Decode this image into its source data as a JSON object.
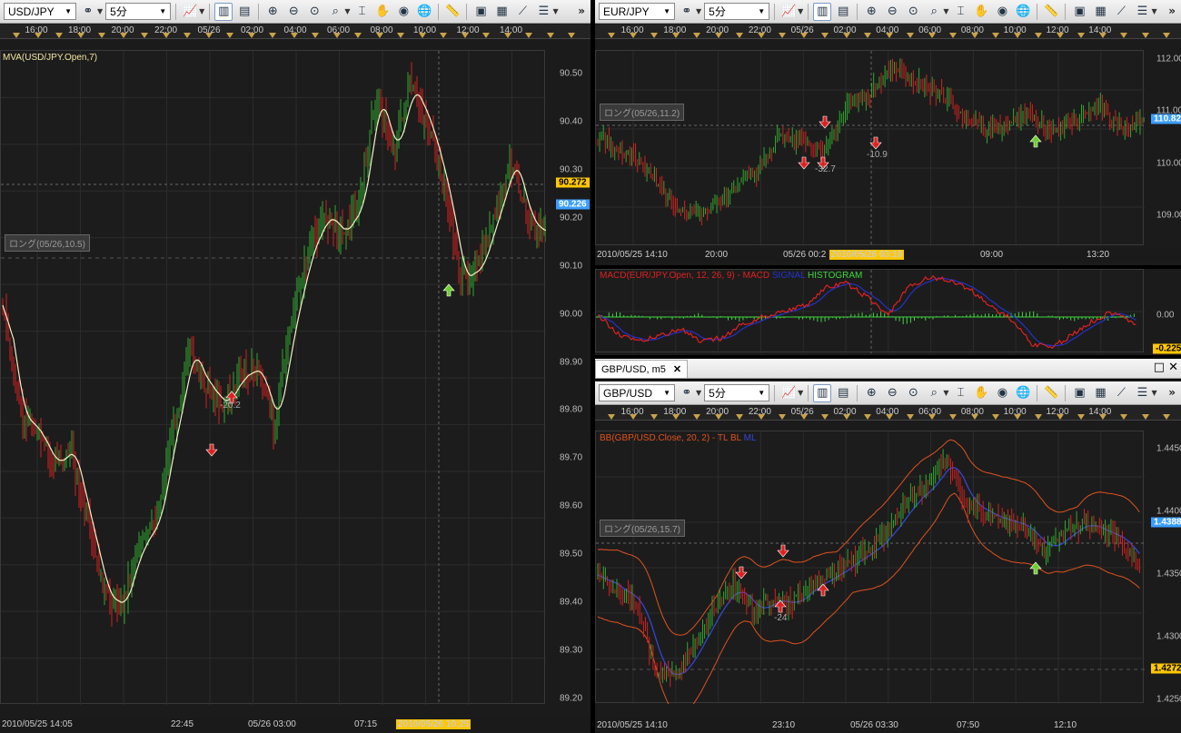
{
  "toolbar_icons": [
    "chart-type-icon",
    "candle-icon",
    "line-icon",
    "zoom-in-icon",
    "zoom-out-icon",
    "zoom-fit-icon",
    "zoom-range-icon",
    "crosshair-icon",
    "trade-icon",
    "eye-icon",
    "globe-icon",
    "ruler-icon",
    "picture-icon",
    "save-chart-icon",
    "draw-line-icon",
    "settings-icon"
  ],
  "colors": {
    "up": "#2ea82e",
    "down": "#d42020",
    "ma": "#f3f0c8",
    "bb_band": "#e0521e",
    "bb_mid": "#3346d6",
    "macd": "#e02020",
    "signal": "#2233cc",
    "hist": "#3fd63f",
    "price_yellow": "#ffc800",
    "price_blue": "#3a9eff"
  },
  "left": {
    "symbol": "USD/JPY",
    "timeframe": "5分",
    "top_times": [
      "16:00",
      "18:00",
      "20:00",
      "22:00",
      "05/26",
      "02:00",
      "04:00",
      "06:00",
      "08:00",
      "10:00",
      "12:00",
      "14:00"
    ],
    "indicator": "MVA(USD/JPY.Open,7)",
    "position_badge": "ロング(05/26,10.5)",
    "trade_label": "-20.2",
    "y_labels": [
      "90.50",
      "90.40",
      "90.30",
      "90.20",
      "90.10",
      "90.00",
      "89.90",
      "89.80",
      "89.70",
      "89.60",
      "89.50",
      "89.40",
      "89.30",
      "89.20"
    ],
    "price_yellow": "90.272",
    "price_blue": "90.226",
    "bottom_times": [
      "2010/05/25 14:05",
      "22:45",
      "05/26 03:00",
      "07:15"
    ],
    "cursor_time": "2010/05/26 10:25"
  },
  "eurjpy": {
    "symbol": "EUR/JPY",
    "timeframe": "5分",
    "top_times": [
      "16:00",
      "18:00",
      "20:00",
      "22:00",
      "05/26",
      "02:00",
      "04:00",
      "06:00",
      "08:00",
      "10:00",
      "12:00",
      "14:00"
    ],
    "position_badge": "ロング(05/26,11.2)",
    "trade_labels": [
      "-32.7",
      "-10.9"
    ],
    "y_labels": [
      "112.00",
      "111.00",
      "110.00",
      "109.00"
    ],
    "price_blue": "110.822",
    "bottom_times": [
      "2010/05/25 14:10",
      "20:00",
      "05/26 00:2",
      "09:00",
      "13:20"
    ],
    "cursor_time": "2010/05/26 03:10"
  },
  "macd": {
    "label_prefix": "MACD(EUR/JPY.Open, 12, 26, 9) - ",
    "label_macd": "MACD",
    "label_signal": "SIGNAL",
    "label_hist": "HISTOGRAM",
    "y_label": "0.00",
    "price_yellow": "-0.225"
  },
  "tab": {
    "title": "GBP/USD, m5",
    "close": "✕",
    "restore": "□",
    "close_win": "✕"
  },
  "gbpusd": {
    "symbol": "GBP/USD",
    "timeframe": "5分",
    "top_times": [
      "16:00",
      "18:00",
      "20:00",
      "22:00",
      "05/26",
      "02:00",
      "04:00",
      "06:00",
      "08:00",
      "10:00",
      "12:00",
      "14:00"
    ],
    "indicator_prefix": "BB(GBP/USD.Close, 20, 2) - ",
    "indicator_tl": "TL",
    "indicator_bl": "BL",
    "indicator_ml": "ML",
    "position_badge": "ロング(05/26,15.7)",
    "trade_label": "-24",
    "y_labels": [
      "1.4450",
      "1.4400",
      "1.4350",
      "1.4300",
      "1.4250"
    ],
    "price_blue": "1.43882",
    "price_yellow": "1.42728",
    "bottom_times": [
      "2010/05/25 14:10",
      "23:10",
      "05/26 03:30",
      "07:50",
      "12:10"
    ]
  }
}
